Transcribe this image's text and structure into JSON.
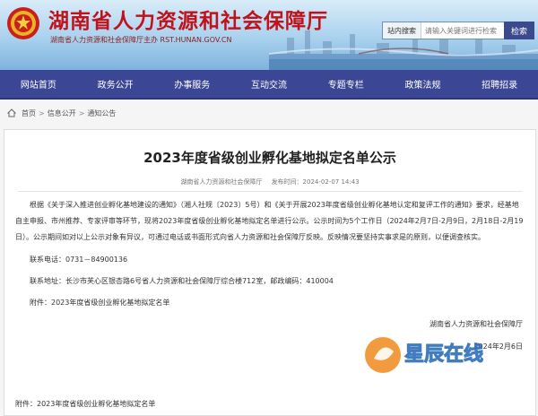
{
  "header": {
    "site_title": "湖南省人力资源和社会保障厅",
    "site_subtitle": "湖南省人力资源和社会保障厅主办 RST.HUNAN.GOV.CN",
    "search_scope": "站内搜索",
    "search_placeholder": "请输入关键词进行检索",
    "search_button": "检索"
  },
  "nav": {
    "items": [
      "网站首页",
      "政务公开",
      "办事服务",
      "互动交流",
      "专题专栏",
      "政策法规",
      "招聘招录"
    ]
  },
  "breadcrumb": {
    "items": [
      "首页",
      "信息公开",
      "通知公告"
    ],
    "separator": ">"
  },
  "article": {
    "title": "2023年度省级创业孵化基地拟定名单公示",
    "source": "湖南省人力资源和社会保障厅",
    "publish_time": "发布时间：2024-02-07 14:43",
    "paragraph": "根据《关于深入推进创业孵化基地建设的通知》（湘人社规〔2023〕5号）和《关于开展2023年度省级创业孵化基地认定和复评工作的通知》要求，经基地自主申报、市州推荐、专家评审等环节，现将2023年度省级创业孵化基地拟定名单进行公示。公示时间为5个工作日（2024年2月7日-2月9日，2月18日-2月19日）。公示期间如对以上公示对象有异议，可通过电话或书面形式向省人力资源和社会保障厅反映。反映情况要坚持实事求是的原则，以便调查核实。",
    "phone": "联系电话：0731－84900136",
    "address": "联系地址：长沙市芙心区银杏路6号省人力资源和社会保障厅综合楼712室，邮政编码：410004",
    "attachment": "附件：2023年度省级创业孵化基地拟定名单",
    "signature": "湖南省人力资源和社会保障厅",
    "date": "2024年2月6日",
    "attachment_footer": "附件：2023年度省级创业孵化基地拟定名单"
  },
  "watermark": {
    "text": "星辰在线",
    "url": "www.changsha.cn"
  }
}
